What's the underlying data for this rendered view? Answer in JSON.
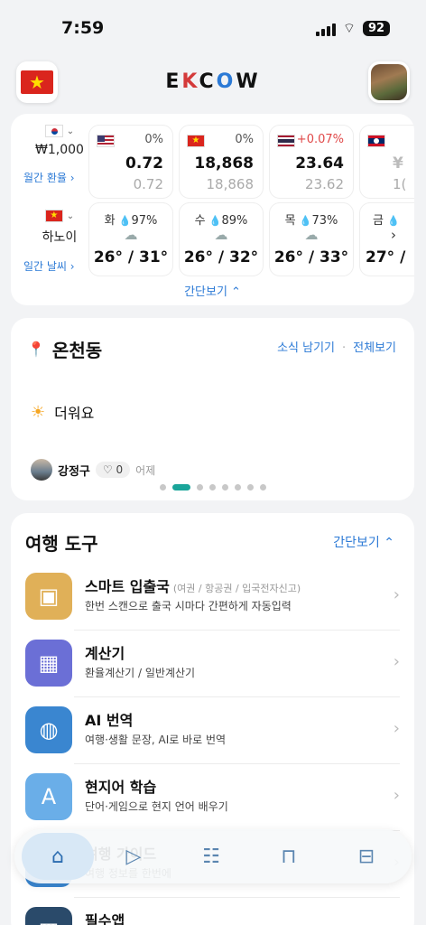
{
  "status": {
    "time": "7:59",
    "battery": "92"
  },
  "header": {
    "logo_parts": [
      "E",
      "K",
      "C",
      "O",
      "W"
    ]
  },
  "exchange": {
    "base_amount": "₩1,000",
    "monthly_link": "월간 환율 ›",
    "rates": [
      {
        "flag": "us-flag",
        "change": "0%",
        "value": "0.72",
        "prev": "0.72"
      },
      {
        "flag": "vn-flag",
        "change": "0%",
        "value": "18,868",
        "prev": "18,868"
      },
      {
        "flag": "th-flag",
        "change": "+0.07%",
        "value": "23.64",
        "prev": "23.62"
      },
      {
        "flag": "la-flag",
        "change": "",
        "value": "¥",
        "prev": "1("
      }
    ]
  },
  "weather": {
    "city": "하노이",
    "monthly_link": "일간 날씨 ›",
    "days": [
      {
        "day": "화",
        "rain": "97%",
        "temp": "26° / 31°"
      },
      {
        "day": "수",
        "rain": "89%",
        "temp": "26° / 32°"
      },
      {
        "day": "목",
        "rain": "73%",
        "temp": "26° / 33°"
      },
      {
        "day": "금",
        "rain": "",
        "temp": "27° /"
      }
    ],
    "collapse_label": "간단보기 ⌃"
  },
  "community": {
    "location": "온천동",
    "leave_news": "소식 남기기",
    "view_all": "전체보기",
    "post_text": "더워요",
    "author": "강정구",
    "likes": "0",
    "time_ago": "어제",
    "page_count": 8,
    "active_page": 1
  },
  "tools": {
    "title": "여행 도구",
    "toggle": "간단보기 ⌃",
    "items": [
      {
        "name": "스마트 입출국",
        "tag": "(여권 / 항공권 / 입국전자신고)",
        "desc": "한번 스캔으로 출국 시마다 간편하게 자동입력",
        "icon": "passport-icon",
        "color": "#e0b058"
      },
      {
        "name": "계산기",
        "tag": "",
        "desc": "환율계산기 / 일반계산기",
        "icon": "calculator-icon",
        "color": "#6b6fd6"
      },
      {
        "name": "AI 번역",
        "tag": "",
        "desc": "여행·생활 문장, AI로 바로 번역",
        "icon": "globe-icon",
        "color": "#3a86d0"
      },
      {
        "name": "현지어 학습",
        "tag": "",
        "desc": "단어·게임으로 현지 언어 배우기",
        "icon": "alphabet-icon",
        "color": "#6aaee8"
      },
      {
        "name": "여행 가이드",
        "tag": "",
        "desc": "여행 정보를 한번에",
        "icon": "guide-icon",
        "color": "#3a86d0"
      },
      {
        "name": "필수앱",
        "tag": "",
        "desc": "",
        "icon": "apps-icon",
        "color": "#2a4a6a"
      }
    ]
  }
}
